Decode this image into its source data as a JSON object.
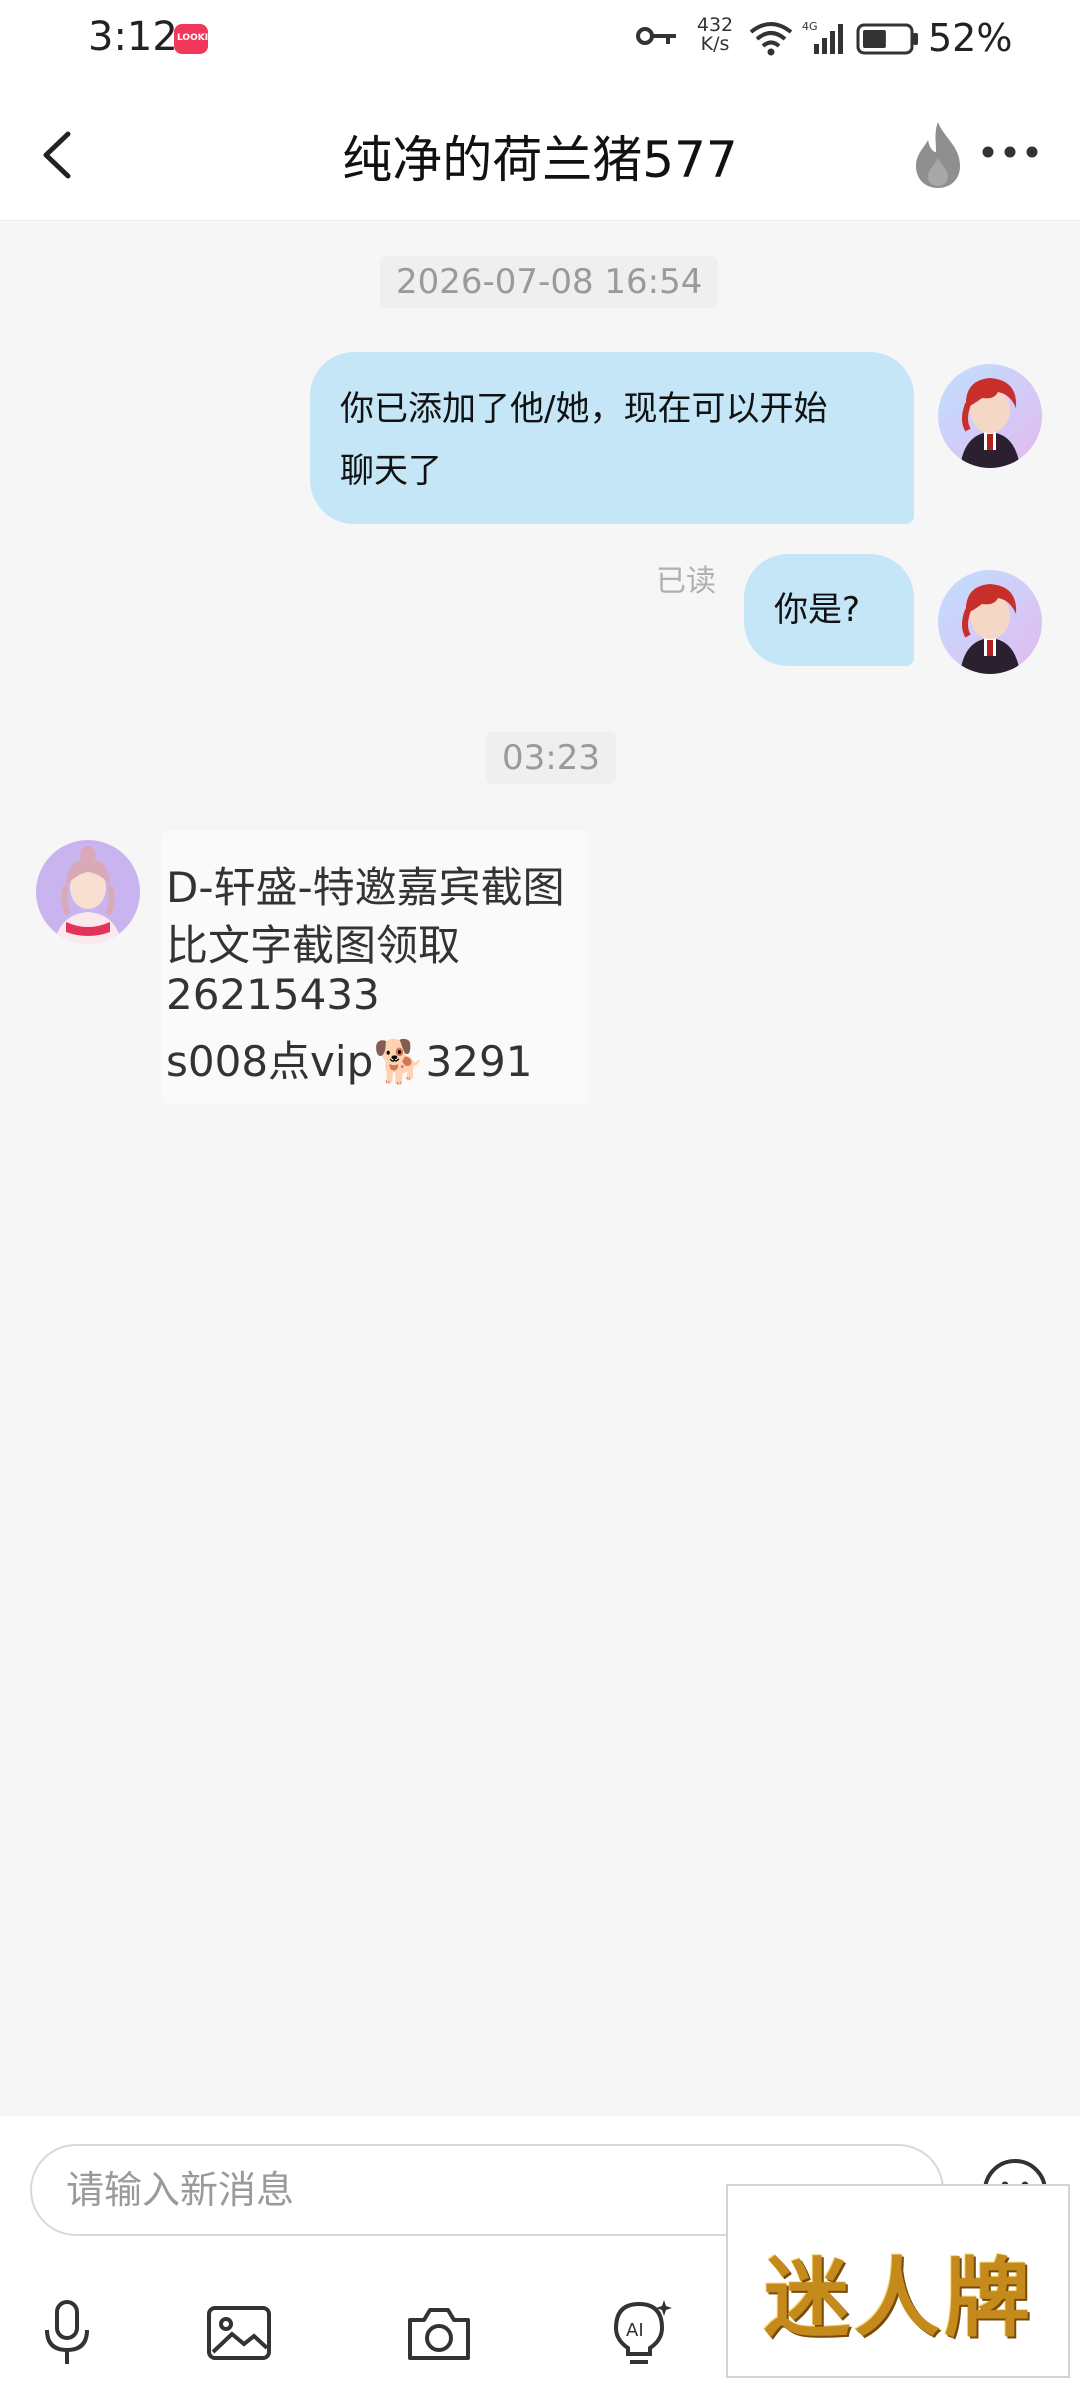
{
  "status_bar": {
    "time": "3:12",
    "app_badge_text": "LOOKIN",
    "net_speed": "432 K/s",
    "net_speed_value": "432",
    "net_speed_unit": "K/s",
    "network_type": "4G",
    "battery": "52%",
    "battery_level": 0.52
  },
  "header": {
    "title": "纯净的荷兰猪577",
    "back_icon": "chevron-left-icon",
    "fire_icon": "fire-icon",
    "more_icon": "more-icon"
  },
  "chat": {
    "timestamp_1": "2026-07-08 16:54",
    "messages_out": [
      {
        "text_line1": "你已添加了他/她，现在可以开始",
        "text_line2": "聊天了"
      },
      {
        "text": "你是?",
        "status": "已读"
      }
    ],
    "timestamp_2": "03:23",
    "image_message_lines": [
      "D-轩盛-特邀嘉宾截图",
      "比文字截图领取",
      "26215433",
      "s008点vip🐕3291"
    ]
  },
  "input": {
    "placeholder": "请输入新消息",
    "tools": [
      "microphone-icon",
      "image-icon",
      "camera-icon",
      "ai-bulb-icon"
    ]
  },
  "ad_overlay": {
    "text": "迷人牌"
  },
  "colors": {
    "bubble_out": "#c4e6f7",
    "background": "#f6f6f6",
    "ad_gold": "#c48a1c"
  }
}
